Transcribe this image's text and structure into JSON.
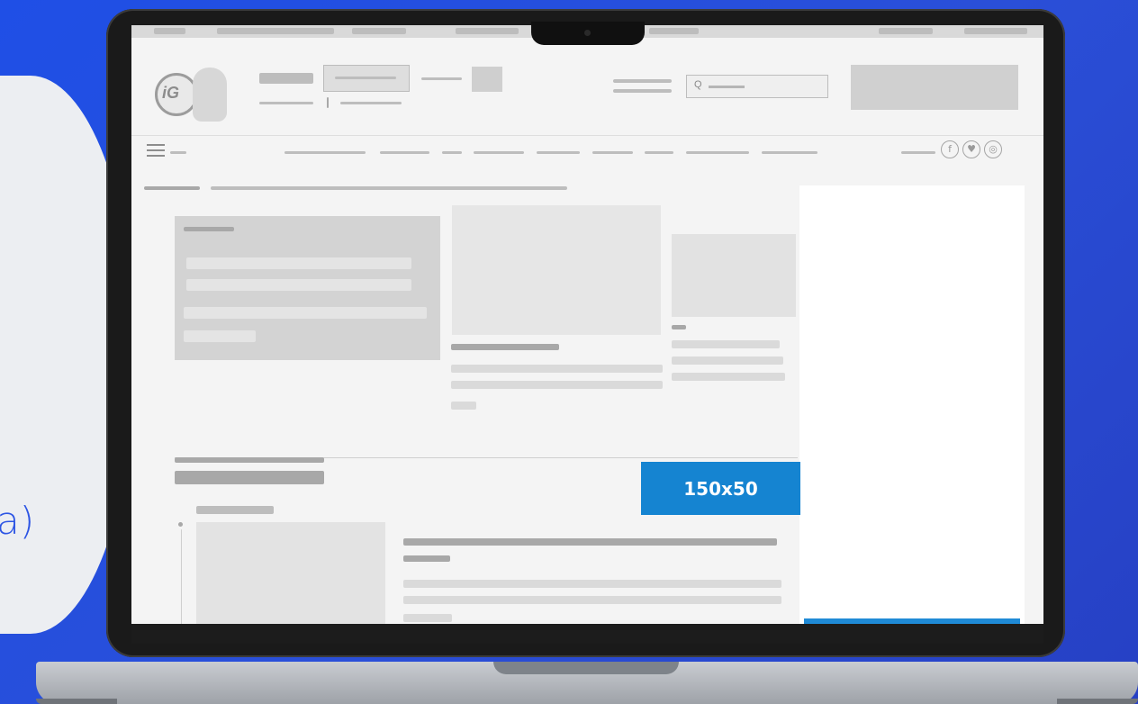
{
  "background": {
    "accent": "#2a4fd8",
    "partial_text": "a)"
  },
  "screen": {
    "search": {
      "icon": "search-icon",
      "glyph": "Q"
    },
    "social": [
      {
        "name": "facebook-icon",
        "glyph": "f"
      },
      {
        "name": "twitter-icon",
        "glyph": "♥"
      },
      {
        "name": "instagram-icon",
        "glyph": "◎"
      }
    ],
    "highlight_color": "#1584d1"
  },
  "ad_placeholder": {
    "label": "150x50"
  }
}
